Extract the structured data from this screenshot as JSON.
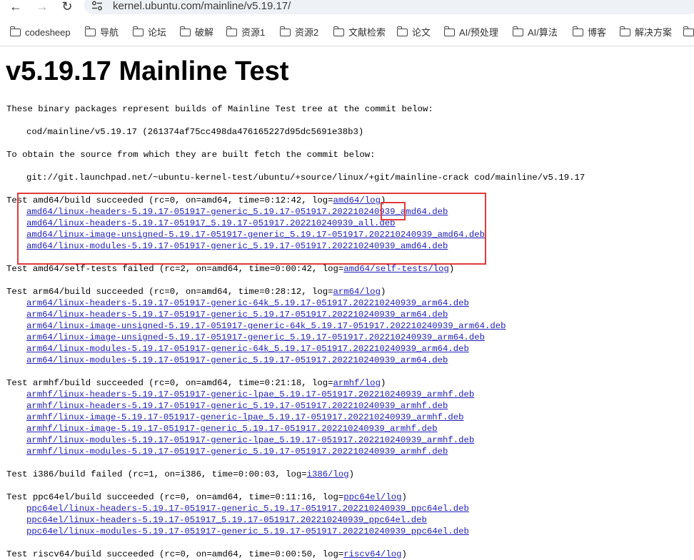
{
  "browser": {
    "url": "kernel.ubuntu.com/mainline/v5.19.17/",
    "bookmarks": [
      "codesheep",
      "导航",
      "论坛",
      "破解",
      "资源1",
      "资源2",
      "文献检索",
      "论文",
      "AI/预处理",
      "AI/算法",
      "博客",
      "解决方案"
    ]
  },
  "page": {
    "title": "v5.19.17 Mainline Test",
    "intro": "These binary packages represent builds of Mainline Test tree at the commit below:",
    "commit": "cod/mainline/v5.19.17 (261374af75cc498da476165227d95dc5691e38b3)",
    "source_intro": "To obtain the source from which they are built fetch the commit below:",
    "source_cmd": "git://git.launchpad.net/~ubuntu-kernel-test/ubuntu/+source/linux/+git/mainline-crack cod/mainline/v5.19.17",
    "sections": [
      {
        "text": "Test amd64/build succeeded (rc=0, on=amd64, time=0:12:42, log=",
        "log": "amd64/log",
        "packages": [
          "amd64/linux-headers-5.19.17-051917-generic_5.19.17-051917.202210240939_amd64.deb",
          "amd64/linux-headers-5.19.17-051917_5.19.17-051917.202210240939_all.deb",
          "amd64/linux-image-unsigned-5.19.17-051917-generic_5.19.17-051917.202210240939_amd64.deb",
          "amd64/linux-modules-5.19.17-051917-generic_5.19.17-051917.202210240939_amd64.deb"
        ]
      },
      {
        "text": "Test amd64/self-tests failed (rc=2, on=amd64, time=0:00:42, log=",
        "log": "amd64/self-tests/log",
        "packages": []
      },
      {
        "text": "Test arm64/build succeeded (rc=0, on=amd64, time=0:28:12, log=",
        "log": "arm64/log",
        "packages": [
          "arm64/linux-headers-5.19.17-051917-generic-64k_5.19.17-051917.202210240939_arm64.deb",
          "arm64/linux-headers-5.19.17-051917-generic_5.19.17-051917.202210240939_arm64.deb",
          "arm64/linux-image-unsigned-5.19.17-051917-generic-64k_5.19.17-051917.202210240939_arm64.deb",
          "arm64/linux-image-unsigned-5.19.17-051917-generic_5.19.17-051917.202210240939_arm64.deb",
          "arm64/linux-modules-5.19.17-051917-generic-64k_5.19.17-051917.202210240939_arm64.deb",
          "arm64/linux-modules-5.19.17-051917-generic_5.19.17-051917.202210240939_arm64.deb"
        ]
      },
      {
        "text": "Test armhf/build succeeded (rc=0, on=amd64, time=0:21:18, log=",
        "log": "armhf/log",
        "packages": [
          "armhf/linux-headers-5.19.17-051917-generic-lpae_5.19.17-051917.202210240939_armhf.deb",
          "armhf/linux-headers-5.19.17-051917-generic_5.19.17-051917.202210240939_armhf.deb",
          "armhf/linux-image-5.19.17-051917-generic-lpae_5.19.17-051917.202210240939_armhf.deb",
          "armhf/linux-image-5.19.17-051917-generic_5.19.17-051917.202210240939_armhf.deb",
          "armhf/linux-modules-5.19.17-051917-generic-lpae_5.19.17-051917.202210240939_armhf.deb",
          "armhf/linux-modules-5.19.17-051917-generic_5.19.17-051917.202210240939_armhf.deb"
        ]
      },
      {
        "text": "Test i386/build failed (rc=1, on=i386, time=0:00:03, log=",
        "log": "i386/log",
        "packages": []
      },
      {
        "text": "Test ppc64el/build succeeded (rc=0, on=amd64, time=0:11:16, log=",
        "log": "ppc64el/log",
        "packages": [
          "ppc64el/linux-headers-5.19.17-051917-generic_5.19.17-051917.202210240939_ppc64el.deb",
          "ppc64el/linux-headers-5.19.17-051917_5.19.17-051917.202210240939_ppc64el.deb",
          "ppc64el/linux-modules-5.19.17-051917-generic_5.19.17-051917.202210240939_ppc64el.deb"
        ]
      },
      {
        "text": "Test riscv64/build succeeded (rc=0, on=amd64, time=0:00:50, log=",
        "log": "riscv64/log",
        "packages": []
      }
    ]
  },
  "colors": {
    "link": "#1f1fb7",
    "highlight": "#e03b3b"
  }
}
